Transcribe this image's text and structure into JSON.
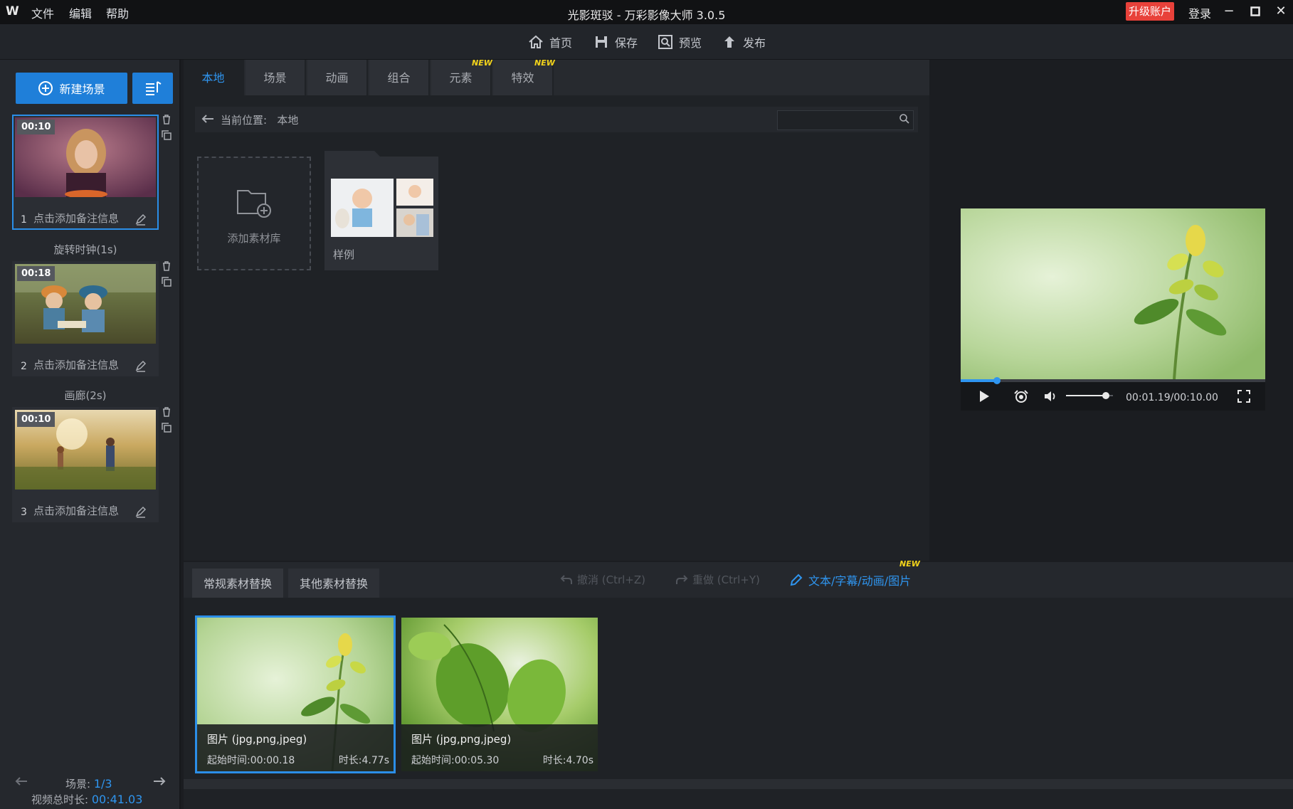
{
  "titlebar": {
    "logo": "W",
    "menus": [
      "文件",
      "编辑",
      "帮助"
    ],
    "title": "光影斑驳 - 万彩影像大师 3.0.5",
    "upgrade": "升级账户",
    "login": "登录"
  },
  "toolbar": {
    "home": "首页",
    "save": "保存",
    "preview": "预览",
    "publish": "发布"
  },
  "sidebar": {
    "new_scene": "新建场景",
    "scenes": [
      {
        "index": "1",
        "time": "00:10",
        "note": "点击添加备注信息"
      },
      {
        "index": "2",
        "time": "00:18",
        "note": "点击添加备注信息"
      },
      {
        "index": "3",
        "time": "00:10",
        "note": "点击添加备注信息"
      }
    ],
    "transitions": [
      "旋转时钟(1s)",
      "画廊(2s)"
    ],
    "scene_count_label": "场景: ",
    "scene_count_value": "1/3",
    "duration_label": "视频总时长: ",
    "duration_value": "00:41.03"
  },
  "library": {
    "tabs": [
      "本地",
      "场景",
      "动画",
      "组合",
      "元素",
      "特效"
    ],
    "new_badge": "NEW",
    "path_label": "当前位置:",
    "path_value": "本地",
    "add_library": "添加素材库",
    "sample_folder": "样例"
  },
  "preview": {
    "time_readout": "00:01.19/00:10.00",
    "progress": 0.12,
    "volume": 0.85
  },
  "replace": {
    "tabs": [
      "常规素材替换",
      "其他素材替换"
    ],
    "undo": "撤消 (Ctrl+Z)",
    "redo": "重做 (Ctrl+Y)",
    "text_edit": "文本/字幕/动画/图片",
    "new_badge": "NEW",
    "items": [
      {
        "type": "图片 (jpg,png,jpeg)",
        "start": "起始时间:00:00.18",
        "duration": "时长:4.77s"
      },
      {
        "type": "图片 (jpg,png,jpeg)",
        "start": "起始时间:00:05.30",
        "duration": "时长:4.70s"
      }
    ]
  },
  "colors": {
    "accent": "#2f95ef",
    "button": "#1f7fd9",
    "upgrade": "#e8413a",
    "badge": "#f2d31b"
  }
}
